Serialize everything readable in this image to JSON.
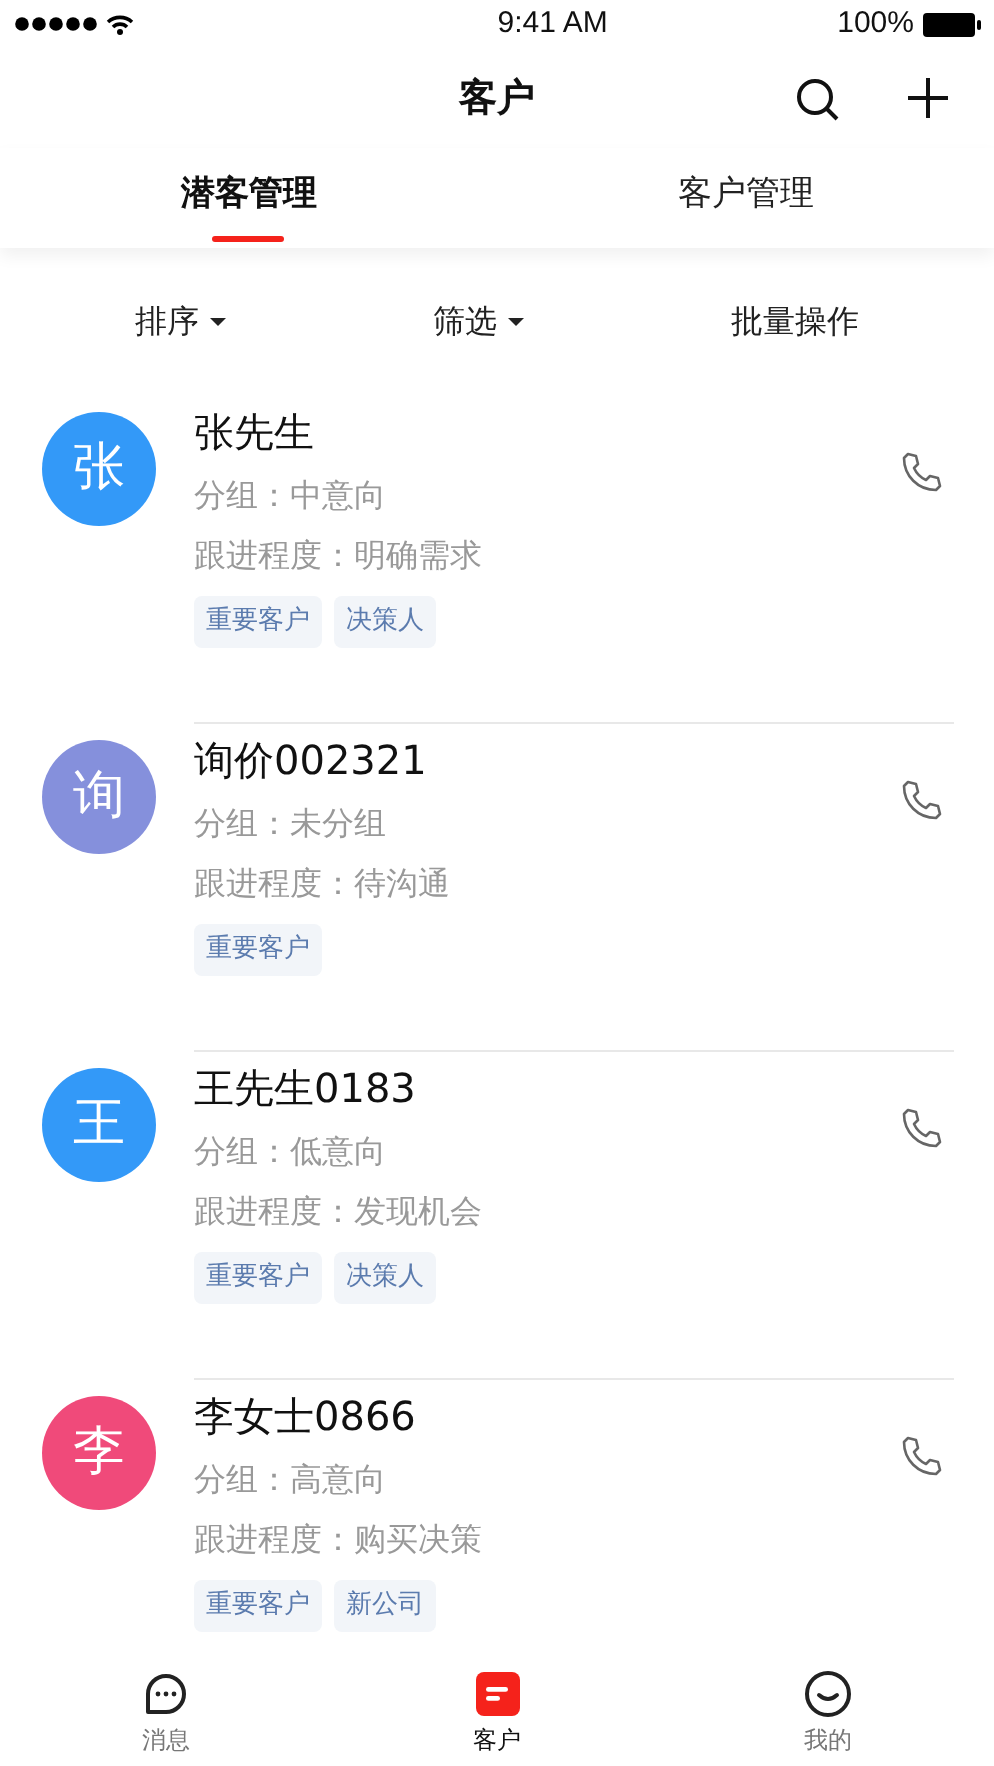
{
  "status_bar": {
    "time": "9:41 AM",
    "battery": "100%"
  },
  "nav": {
    "title": "客户"
  },
  "tabs": [
    {
      "label": "潜客管理",
      "selected": true
    },
    {
      "label": "客户管理",
      "selected": false
    }
  ],
  "filters": [
    {
      "label": "排序",
      "kind": "dropdown"
    },
    {
      "label": "筛选",
      "kind": "dropdown"
    },
    {
      "label": "批量操作",
      "kind": "action"
    }
  ],
  "customers": [
    {
      "avatar": "张",
      "color": "#3399f8",
      "name": "张先生",
      "group": "分组：中意向",
      "progress": "跟进程度：明确需求",
      "tags": [
        "重要客户",
        "决策人"
      ]
    },
    {
      "avatar": "询",
      "color": "#8590dc",
      "name": "询价002321",
      "group": "分组：未分组",
      "progress": "跟进程度：待沟通",
      "tags": [
        "重要客户"
      ]
    },
    {
      "avatar": "王",
      "color": "#3399f8",
      "name": "王先生0183",
      "group": "分组：低意向",
      "progress": "跟进程度：发现机会",
      "tags": [
        "重要客户",
        "决策人"
      ]
    },
    {
      "avatar": "李",
      "color": "#f04a7a",
      "name": "李女士0866",
      "group": "分组：高意向",
      "progress": "跟进程度：购买决策",
      "tags": [
        "重要客户",
        "新公司"
      ]
    }
  ],
  "bottom_tabs": [
    {
      "label": "消息",
      "kind": "chat",
      "selected": false
    },
    {
      "label": "客户",
      "kind": "customers",
      "selected": true
    },
    {
      "label": "我的",
      "kind": "profile",
      "selected": false
    }
  ]
}
